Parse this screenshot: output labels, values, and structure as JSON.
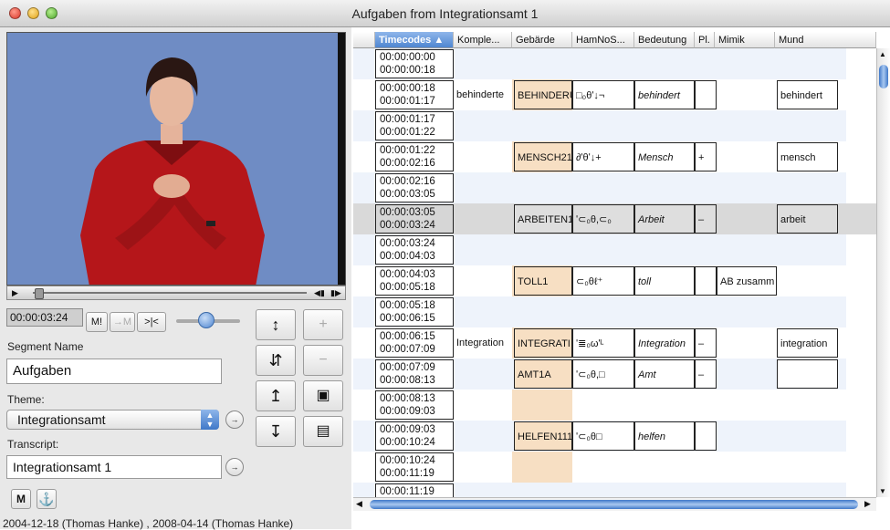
{
  "window": {
    "title": "Aufgaben from Integrationsamt 1"
  },
  "controls": {
    "timecode": "00:00:03:24",
    "mark_label": "M!",
    "to_mark_label": "→M",
    "range_label": ">|<",
    "plus_label": "+",
    "minus_label": "−",
    "segment_name_label": "Segment Name",
    "segment_name_value": "Aufgaben",
    "theme_label": "Theme:",
    "theme_value": "Integrationsamt",
    "transcript_label": "Transcript:",
    "transcript_value": "Integrationsamt 1",
    "m_label": "M",
    "status": "2004-12-18 (Thomas Hanke) , 2008-04-14 (Thomas Hanke)"
  },
  "table": {
    "columns": [
      "Timecodes ▲",
      "Komple...",
      "Gebärde",
      "HamNoS...",
      "Bedeutung",
      "Pl.",
      "Mimik",
      "Mund"
    ],
    "rows": [
      {
        "tc1": "00:00:00:00",
        "tc2": "00:00:00:18",
        "komplex": "",
        "gebaerde": "",
        "hamnosys": "",
        "bedeutung": "",
        "pl": "",
        "mimik": "",
        "mund": ""
      },
      {
        "tc1": "00:00:00:18",
        "tc2": "00:00:01:17",
        "komplex": "behinderte",
        "gebaerde": "BEHINDERU",
        "hamnosys": "□₀θʹ↓¬",
        "bedeutung": "behindert",
        "pl": "",
        "mimik": "",
        "mund": "behindert"
      },
      {
        "tc1": "00:00:01:17",
        "tc2": "00:00:01:22",
        "komplex": "",
        "gebaerde": "",
        "hamnosys": "",
        "bedeutung": "",
        "pl": "",
        "mimik": "",
        "mund": ""
      },
      {
        "tc1": "00:00:01:22",
        "tc2": "00:00:02:16",
        "komplex": "",
        "gebaerde": "MENSCH21",
        "hamnosys": "∂ʹθʹ↓+",
        "bedeutung": "Mensch",
        "pl": "+",
        "mimik": "",
        "mund": "mensch"
      },
      {
        "tc1": "00:00:02:16",
        "tc2": "00:00:03:05",
        "komplex": "",
        "gebaerde": "",
        "hamnosys": "",
        "bedeutung": "",
        "pl": "",
        "mimik": "",
        "mund": ""
      },
      {
        "tc1": "00:00:03:05",
        "tc2": "00:00:03:24",
        "komplex": "",
        "gebaerde": "ARBEITEN1",
        "hamnosys": "ʹ⊂₀θ,⊂₀",
        "bedeutung": "Arbeit",
        "pl": "–",
        "mimik": "",
        "mund": "arbeit"
      },
      {
        "tc1": "00:00:03:24",
        "tc2": "00:00:04:03",
        "komplex": "",
        "gebaerde": "",
        "hamnosys": "",
        "bedeutung": "",
        "pl": "",
        "mimik": "",
        "mund": ""
      },
      {
        "tc1": "00:00:04:03",
        "tc2": "00:00:05:18",
        "komplex": "",
        "gebaerde": "TOLL1",
        "hamnosys": "⊂₀θℓ⁺",
        "bedeutung": "toll",
        "pl": "",
        "mimik": "AB zusamm",
        "mund": ""
      },
      {
        "tc1": "00:00:05:18",
        "tc2": "00:00:06:15",
        "komplex": "",
        "gebaerde": "",
        "hamnosys": "",
        "bedeutung": "",
        "pl": "",
        "mimik": "",
        "mund": ""
      },
      {
        "tc1": "00:00:06:15",
        "tc2": "00:00:07:09",
        "komplex": "Integration",
        "gebaerde": "INTEGRATI",
        "hamnosys": "ʹ≣₀ωʹᴸ",
        "bedeutung": "Integration",
        "pl": "–",
        "mimik": "",
        "mund": "integration"
      },
      {
        "tc1": "00:00:07:09",
        "tc2": "00:00:08:13",
        "komplex": "",
        "gebaerde": "AMT1A",
        "hamnosys": "ʹ⊂₀θ,□",
        "bedeutung": "Amt",
        "pl": "–",
        "mimik": "",
        "mund": ""
      },
      {
        "tc1": "00:00:08:13",
        "tc2": "00:00:09:03",
        "komplex": "",
        "gebaerde": "",
        "hamnosys": "",
        "bedeutung": "",
        "pl": "",
        "mimik": "",
        "mund": ""
      },
      {
        "tc1": "00:00:09:03",
        "tc2": "00:00:10:24",
        "komplex": "",
        "gebaerde": "HELFEN111",
        "hamnosys": "ʹ⊂₀θ□",
        "bedeutung": "helfen",
        "pl": "",
        "mimik": "",
        "mund": ""
      },
      {
        "tc1": "00:00:10:24",
        "tc2": "00:00:11:19",
        "komplex": "",
        "gebaerde": "",
        "hamnosys": "",
        "bedeutung": "",
        "pl": "",
        "mimik": "",
        "mund": ""
      },
      {
        "tc1": "00:00:11:19",
        "tc2": "",
        "komplex": "",
        "gebaerde": "",
        "hamnosys": "",
        "bedeutung": "",
        "pl": "",
        "mimik": "",
        "mund": ""
      }
    ]
  },
  "colors": {
    "gloss_column": "#f7dfc3",
    "header_selected": "#4f86d1",
    "row_band": "#eef3fb",
    "row_highlight": "#d9d9d9",
    "video_background": "#6f8cc4"
  }
}
